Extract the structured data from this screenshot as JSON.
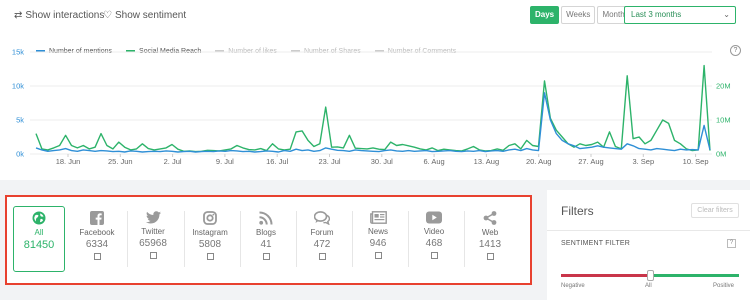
{
  "toolbar": {
    "show_interactions": "Show interactions",
    "show_sentiment": "Show sentiment",
    "periods": [
      "Days",
      "Weeks",
      "Months"
    ],
    "active_period": "Days",
    "range": "Last 3 months"
  },
  "colors": {
    "accent": "#2db36a",
    "mentions": "#2f8fd6",
    "reach": "#2db36a",
    "inactive": "#cccccc",
    "highlight_border": "#e8412f",
    "negative": "#c9354a"
  },
  "chart_data": {
    "type": "line",
    "legend": [
      {
        "name": "Number of mentions",
        "active": true
      },
      {
        "name": "Social Media Reach",
        "active": true
      },
      {
        "name": "Number of likes",
        "active": false
      },
      {
        "name": "Number of Shares",
        "active": false
      },
      {
        "name": "Number of Comments",
        "active": false
      }
    ],
    "x_ticks": [
      "18. Jun",
      "25. Jun",
      "2. Jul",
      "9. Jul",
      "16. Jul",
      "23. Jul",
      "30. Jul",
      "6. Aug",
      "13. Aug",
      "20. Aug",
      "27. Aug",
      "3. Sep",
      "10. Sep"
    ],
    "y_left_ticks": [
      "0k",
      "5k",
      "10k",
      "15k"
    ],
    "y_right_ticks": [
      "0M",
      "10M",
      "20M"
    ],
    "y_left_lim": [
      0,
      15000
    ],
    "y_right_lim": [
      0,
      30000000
    ],
    "series": [
      {
        "name": "Number of mentions",
        "axis": "left",
        "values": [
          900,
          600,
          400,
          500,
          600,
          800,
          500,
          400,
          600,
          500,
          400,
          500,
          450,
          350,
          400,
          300,
          450,
          400,
          300,
          350,
          400,
          350,
          450,
          400,
          300,
          350,
          400,
          300,
          350,
          400,
          350,
          450,
          400,
          500,
          450,
          350,
          400,
          300,
          350,
          450,
          400,
          300,
          500,
          400,
          700,
          500,
          600,
          400,
          500,
          900,
          700,
          550,
          500,
          400,
          600,
          500,
          450,
          400,
          350,
          500,
          600,
          450,
          400,
          500,
          400,
          450,
          500,
          350,
          400,
          450,
          500,
          400,
          350,
          450,
          400,
          500,
          350,
          450,
          500,
          400,
          600,
          700,
          500,
          800,
          600,
          500,
          9000,
          5000,
          3000,
          2000,
          1500,
          1200,
          800,
          900,
          1000,
          1200,
          1000,
          900,
          800,
          700,
          1500,
          1200,
          800,
          700,
          600,
          800,
          700,
          600,
          500,
          700,
          600,
          650,
          600,
          4200,
          600
        ]
      },
      {
        "name": "Social Media Reach",
        "axis": "right",
        "values": [
          6000000,
          1500000,
          1200000,
          1800000,
          2500000,
          5500000,
          2500000,
          1800000,
          2500000,
          1500000,
          2000000,
          6000000,
          2500000,
          1500000,
          3500000,
          2000000,
          1200000,
          1500000,
          3000000,
          1600000,
          1200000,
          1500000,
          1800000,
          2800000,
          1400000,
          800000,
          900000,
          700000,
          800000,
          1100000,
          1000000,
          900000,
          1200000,
          1500000,
          2500000,
          1800000,
          1300000,
          1200000,
          1600000,
          1000000,
          3000000,
          1500000,
          1200000,
          1400000,
          6500000,
          6800000,
          4000000,
          2200000,
          3000000,
          13800000,
          2000000,
          2100000,
          1800000,
          5500000,
          1700000,
          1600000,
          1500000,
          1800000,
          1400000,
          1300000,
          3500000,
          2500000,
          2800000,
          2400000,
          2000000,
          1500000,
          1200000,
          1800000,
          1000000,
          1400000,
          1200000,
          1000000,
          900000,
          1500000,
          2200000,
          1200000,
          900000,
          1000000,
          1500000,
          1100000,
          2500000,
          3000000,
          1500000,
          4000000,
          2500000,
          2200000,
          21500000,
          10500000,
          7000000,
          5000000,
          3000000,
          2000000,
          3000000,
          2500000,
          2800000,
          3500000,
          2000000,
          6500000,
          2200000,
          1500000,
          23000000,
          4500000,
          5000000,
          3000000,
          4000000,
          7000000,
          10000000,
          9000000,
          4000000,
          3000000,
          1500000,
          1000000,
          1200000,
          26000000,
          1000000
        ]
      }
    ]
  },
  "channels": [
    {
      "label": "All",
      "value": "81450",
      "icon": "globe-icon",
      "selected": true
    },
    {
      "label": "Facebook",
      "value": "6334",
      "icon": "facebook-icon"
    },
    {
      "label": "Twitter",
      "value": "65968",
      "icon": "twitter-icon"
    },
    {
      "label": "Instagram",
      "value": "5808",
      "icon": "instagram-icon"
    },
    {
      "label": "Blogs",
      "value": "41",
      "icon": "rss-icon"
    },
    {
      "label": "Forum",
      "value": "472",
      "icon": "forum-icon"
    },
    {
      "label": "News",
      "value": "946",
      "icon": "news-icon"
    },
    {
      "label": "Video",
      "value": "468",
      "icon": "video-icon"
    },
    {
      "label": "Web",
      "value": "1413",
      "icon": "share-icon"
    }
  ],
  "filters": {
    "title": "Filters",
    "clear": "Clear filters",
    "sentiment_title": "SENTIMENT FILTER",
    "help": "?",
    "labels": {
      "negative": "Negative",
      "all": "All",
      "positive": "Positive"
    },
    "slider_position": 0.5
  },
  "chart_help": "?"
}
